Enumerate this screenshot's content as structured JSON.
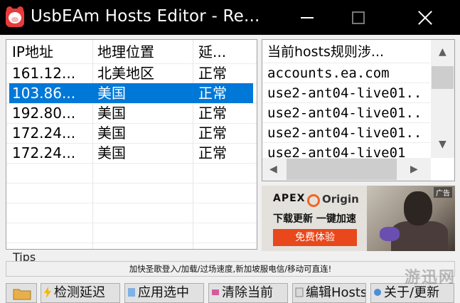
{
  "window": {
    "title": "UsbEAm Hosts Editor - Re..."
  },
  "ip_table": {
    "headers": [
      "IP地址",
      "地理位置",
      "延..."
    ],
    "rows": [
      {
        "ip": "161.12...",
        "location": "北美地区",
        "latency": "正常",
        "selected": false
      },
      {
        "ip": "103.86...",
        "location": "美国",
        "latency": "正常",
        "selected": true
      },
      {
        "ip": "192.80...",
        "location": "美国",
        "latency": "正常",
        "selected": false
      },
      {
        "ip": "172.24...",
        "location": "美国",
        "latency": "正常",
        "selected": false
      },
      {
        "ip": "172.24...",
        "location": "美国",
        "latency": "正常",
        "selected": false
      }
    ]
  },
  "rules": {
    "header": "当前hosts规则涉...",
    "items": [
      "accounts.ea.com",
      "use2-ant04-live01..",
      "use2-ant04-live01..",
      "use2-ant04-live01..",
      "use2-ant04-live01"
    ]
  },
  "ad": {
    "brand": "APEX",
    "partner": "Origin",
    "slogan": "下载更新 一键加速",
    "cta": "免费体验",
    "tag": "广告"
  },
  "tips": {
    "label": "Tips",
    "message": "加快圣歌登入/加载/过场速度,新加坡服电信/移动可直连!"
  },
  "buttons": [
    {
      "label": "检测延迟"
    },
    {
      "label": "应用选中"
    },
    {
      "label": "清除当前"
    },
    {
      "label": "编辑Hosts"
    },
    {
      "label": "关于/更新"
    }
  ],
  "watermark": "游迅网",
  "colors": {
    "selection": "#0078d7",
    "titlebar": "#000000",
    "ad_button": "#e8481c",
    "origin_orange": "#f26522"
  }
}
